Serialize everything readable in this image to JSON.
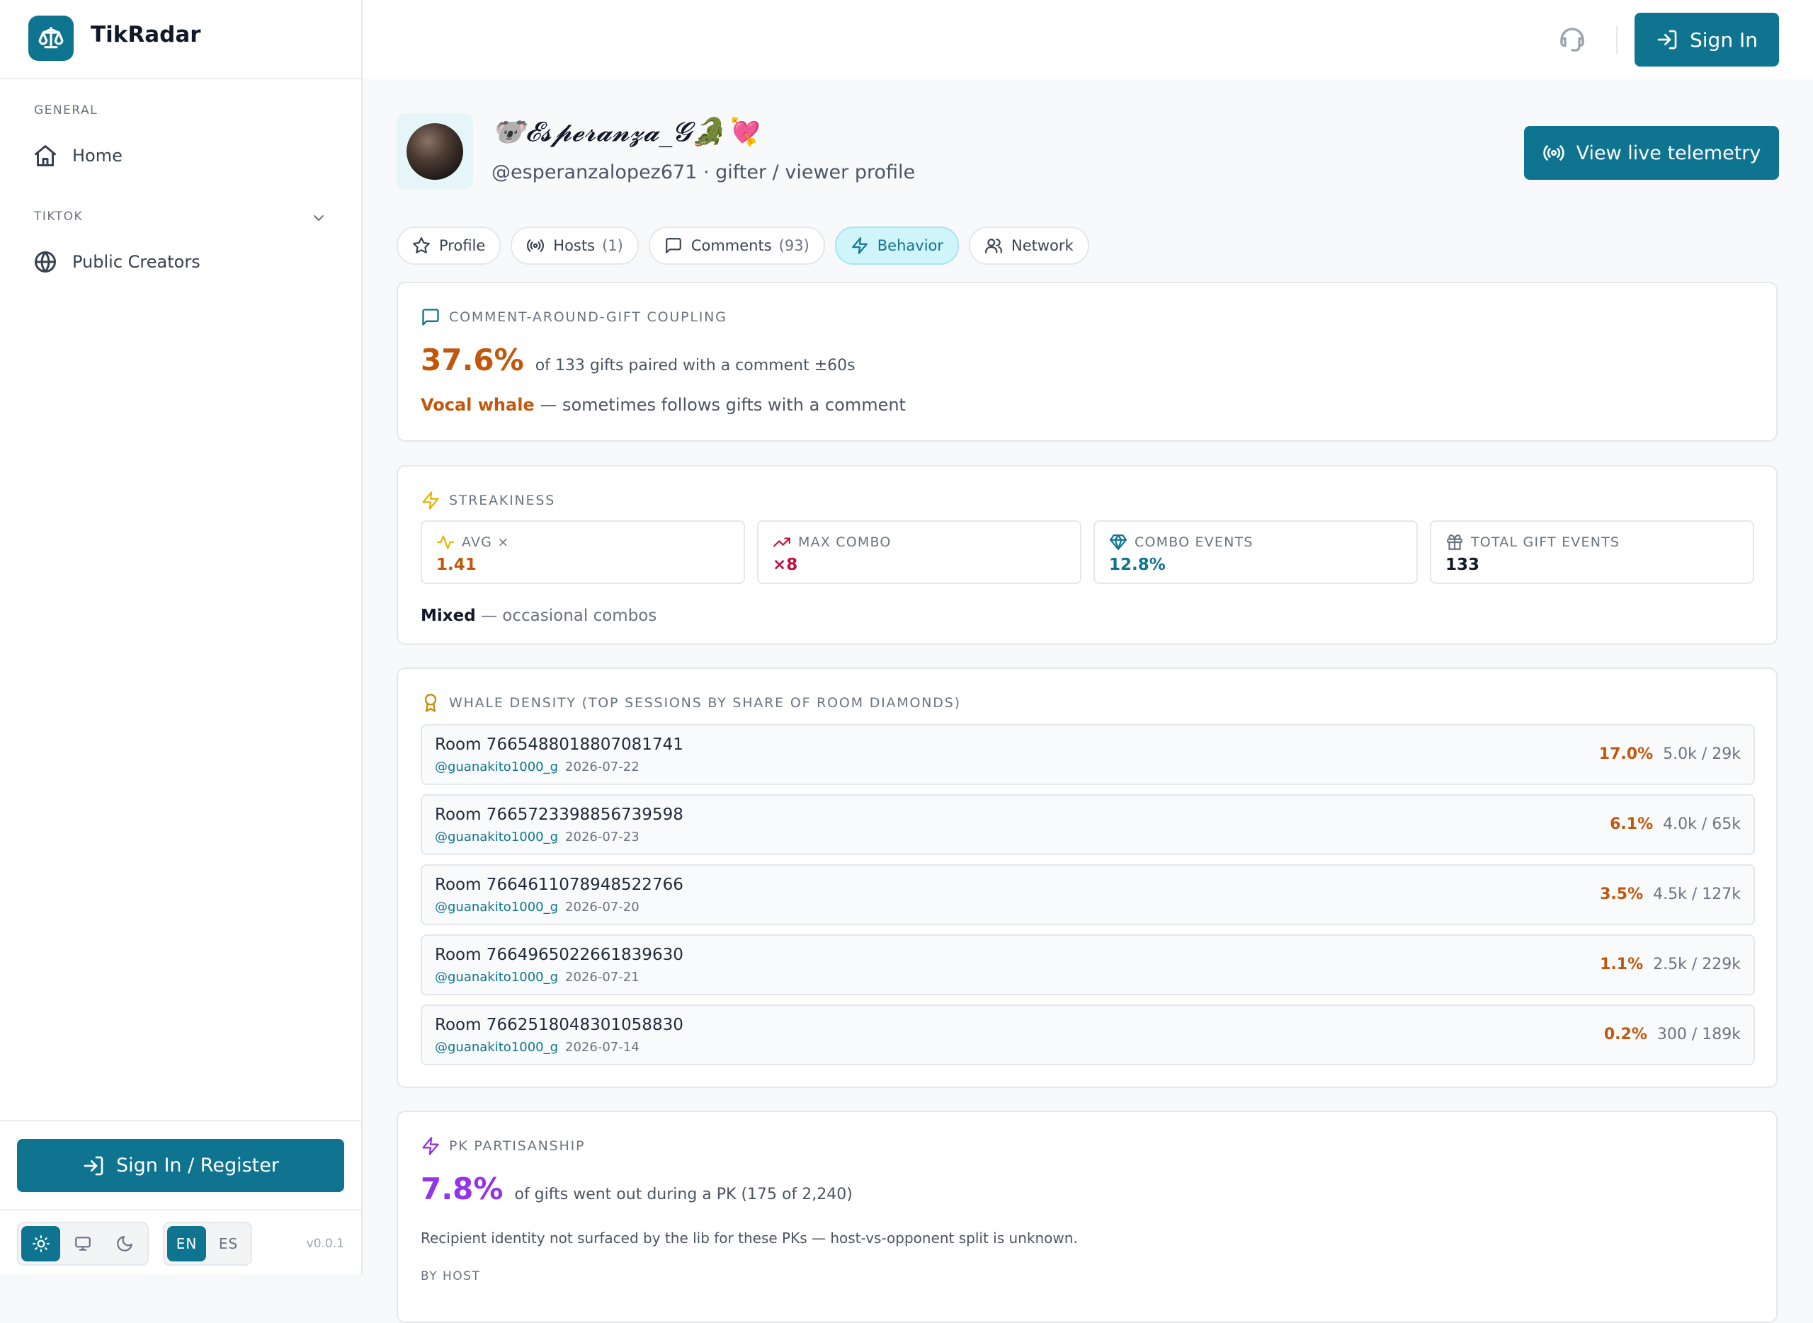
{
  "app": {
    "name": "TikRadar",
    "version": "v0.0.1"
  },
  "sidebar": {
    "general_label": "GENERAL",
    "home_label": "Home",
    "tiktok_label": "TIKTOK",
    "public_creators_label": "Public Creators",
    "register_label": "Sign In / Register",
    "lang_en": "EN",
    "lang_es": "ES"
  },
  "header": {
    "sign_in_label": "Sign In"
  },
  "profile": {
    "display_name": "🐨𝓔𝓼𝓹𝓮𝓻𝓪𝓷𝔃𝓪_𝓖🐊💘",
    "handle": "@esperanzalopez671 · gifter / viewer profile",
    "telemetry_label": "View live telemetry"
  },
  "tabs": [
    {
      "label": "Profile",
      "count": ""
    },
    {
      "label": "Hosts",
      "count": "(1)"
    },
    {
      "label": "Comments",
      "count": "(93)"
    },
    {
      "label": "Behavior",
      "count": ""
    },
    {
      "label": "Network",
      "count": ""
    }
  ],
  "coupling": {
    "title": "COMMENT-AROUND-GIFT COUPLING",
    "value": "37.6%",
    "detail": "of 133 gifts paired with a comment ±60s",
    "verdict": "Vocal whale",
    "verdict_detail": " — sometimes follows gifts with a comment"
  },
  "streakiness": {
    "title": "STREAKINESS",
    "stats": [
      {
        "label": "AVG ×",
        "value": "1.41"
      },
      {
        "label": "MAX COMBO",
        "value": "×8"
      },
      {
        "label": "COMBO EVENTS",
        "value": "12.8%"
      },
      {
        "label": "TOTAL GIFT EVENTS",
        "value": "133"
      }
    ],
    "verdict": "Mixed",
    "verdict_detail": " — occasional combos"
  },
  "whale": {
    "title": "WHALE DENSITY (TOP SESSIONS BY SHARE OF ROOM DIAMONDS)",
    "rooms": [
      {
        "name": "Room 7665488018807081741",
        "host": "@guanakito1000_g",
        "date": "2026-07-22",
        "pct": "17.0%",
        "ratio": "5.0k / 29k"
      },
      {
        "name": "Room 7665723398856739598",
        "host": "@guanakito1000_g",
        "date": "2026-07-23",
        "pct": "6.1%",
        "ratio": "4.0k / 65k"
      },
      {
        "name": "Room 7664611078948522766",
        "host": "@guanakito1000_g",
        "date": "2026-07-20",
        "pct": "3.5%",
        "ratio": "4.5k / 127k"
      },
      {
        "name": "Room 7664965022661839630",
        "host": "@guanakito1000_g",
        "date": "2026-07-21",
        "pct": "1.1%",
        "ratio": "2.5k / 229k"
      },
      {
        "name": "Room 7662518048301058830",
        "host": "@guanakito1000_g",
        "date": "2026-07-14",
        "pct": "0.2%",
        "ratio": "300 / 189k"
      }
    ]
  },
  "pk": {
    "title": "PK PARTISANSHIP",
    "value": "7.8%",
    "detail": "of gifts went out during a PK (175 of 2,240)",
    "note": "Recipient identity not surfaced by the lib for these PKs — host-vs-opponent split is unknown.",
    "by_host_label": "BY HOST"
  },
  "colors": {
    "accent": "#0e7490",
    "orange": "#c2570c",
    "purple": "#9333ea",
    "pink": "#be123c"
  }
}
